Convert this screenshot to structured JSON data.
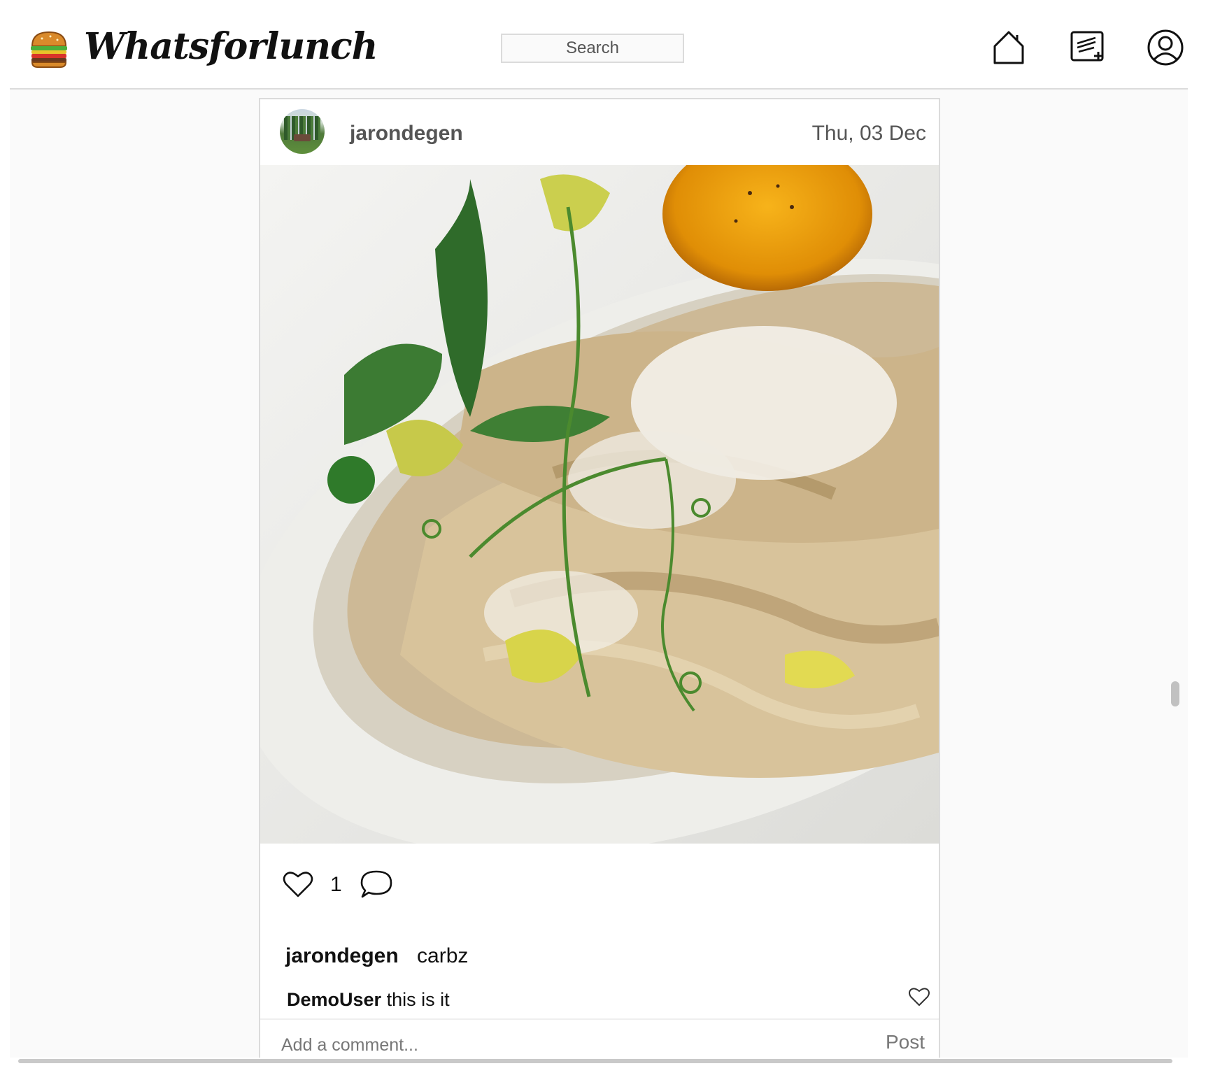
{
  "header": {
    "brand": "Whatsforlunch",
    "search_placeholder": "Search",
    "icons": [
      "burger-logo-icon",
      "home-icon",
      "new-post-icon",
      "profile-icon"
    ]
  },
  "post": {
    "author": "jarondegen",
    "date": "Thu, 03 Dec",
    "like_count": "1",
    "caption": {
      "user": "jarondegen",
      "text": "carbz"
    },
    "comments": [
      {
        "user": "DemoUser",
        "text": " this is it"
      }
    ],
    "add_comment_placeholder": "Add a comment...",
    "post_button": "Post"
  },
  "colors": {
    "border": "#dbdbdb",
    "page_background": "#fafafa",
    "muted_text": "#555555"
  }
}
